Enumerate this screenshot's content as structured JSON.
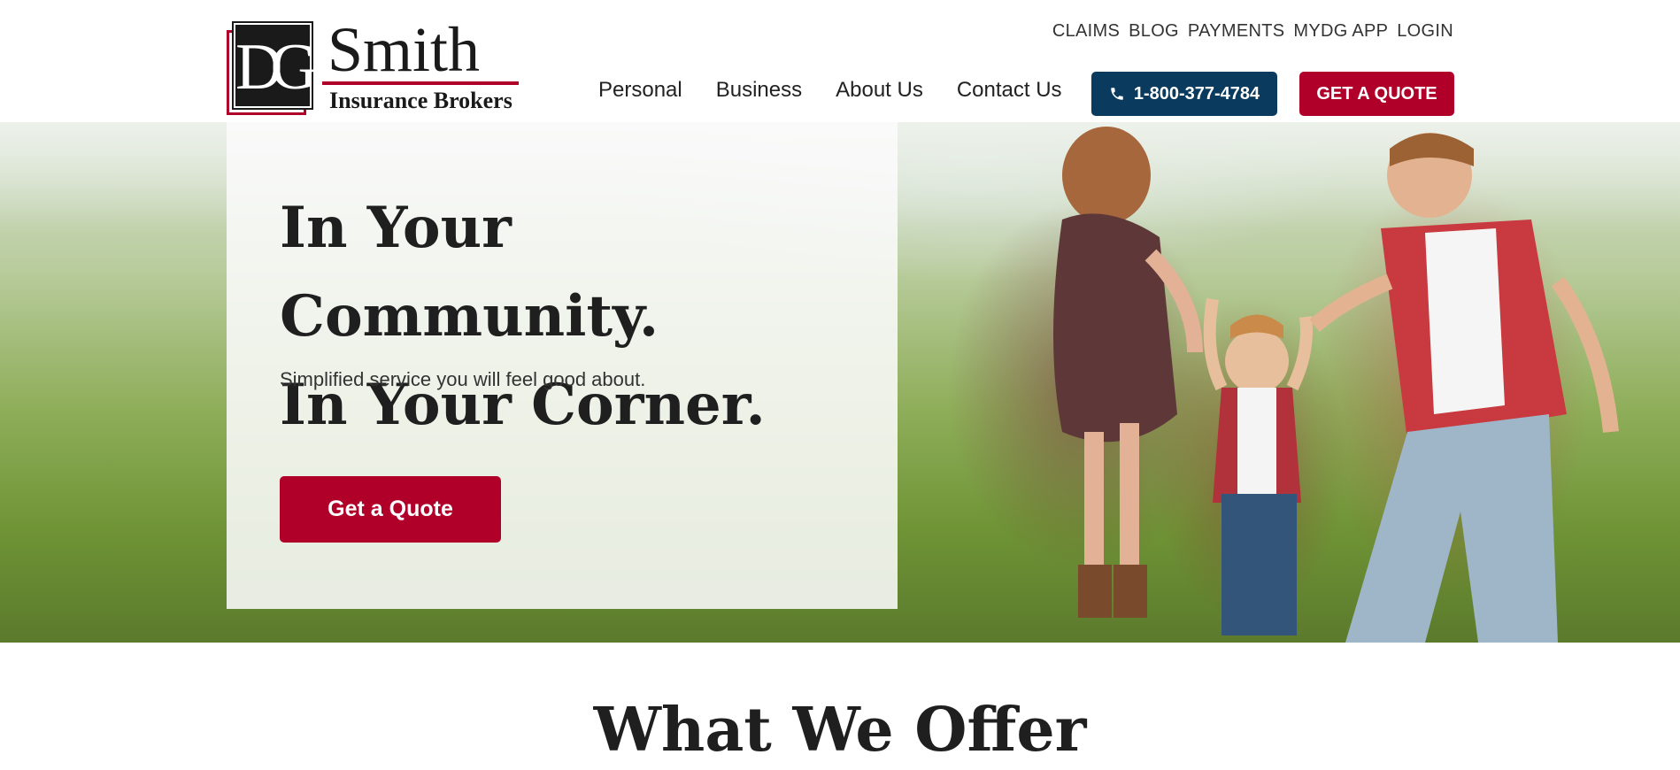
{
  "logo": {
    "monogram": "DG",
    "name": "Smith",
    "tagline": "Insurance Brokers"
  },
  "utility_nav": [
    "CLAIMS",
    "BLOG",
    "PAYMENTS",
    "MYDG APP",
    "LOGIN"
  ],
  "main_nav": [
    "Personal",
    "Business",
    "About Us",
    "Contact Us"
  ],
  "phone_button": {
    "label": "1-800-377-4784",
    "icon": "phone-icon"
  },
  "quote_button_top": "GET A QUOTE",
  "hero": {
    "title_line1": "In Your Community.",
    "title_line2": "In Your Corner.",
    "subtitle": "Simplified service you will feel good about.",
    "cta": "Get a Quote"
  },
  "section": {
    "title": "What We Offer"
  },
  "colors": {
    "brand_red": "#b0002a",
    "phone_navy": "#0a3a5e",
    "text_dark": "#1f1f1f"
  }
}
